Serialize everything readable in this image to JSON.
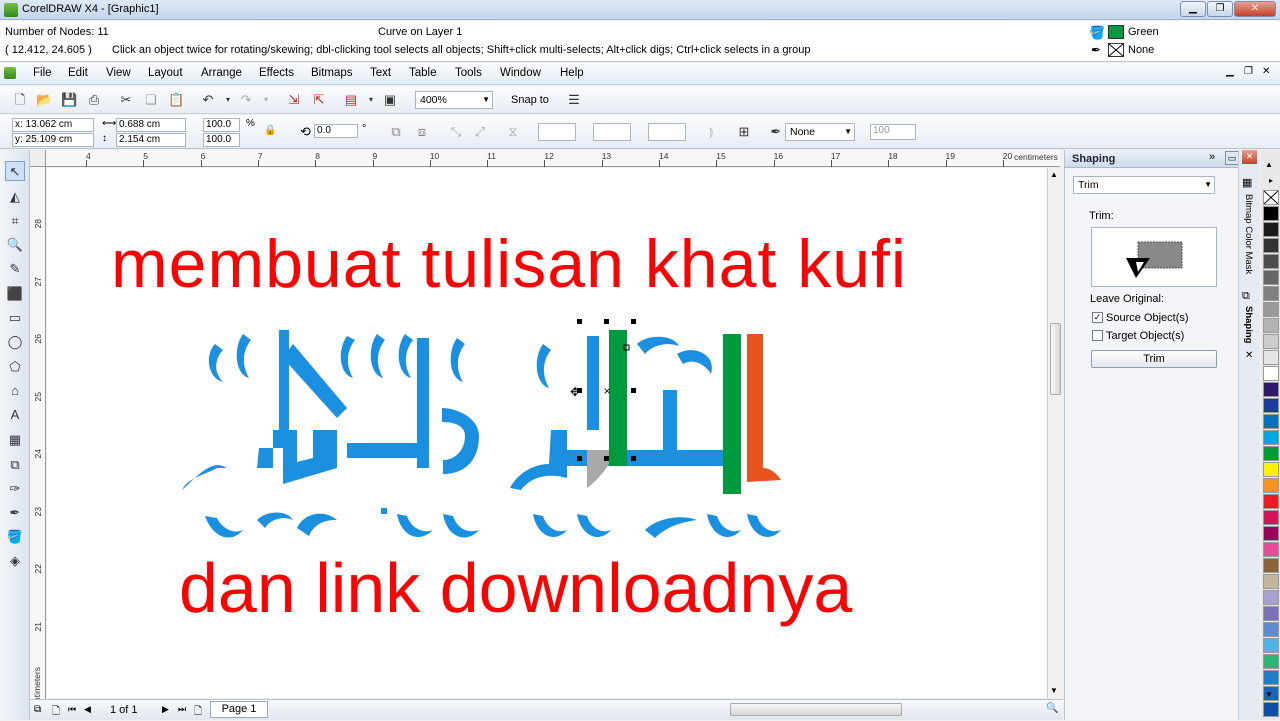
{
  "window": {
    "title": "CorelDRAW X4 - [Graphic1]"
  },
  "status": {
    "nodes": "Number of Nodes: 11",
    "coords": "( 12.412, 24.605 )",
    "object_info": "Curve on Layer 1",
    "hint": "Click an object twice for rotating/skewing; dbl-clicking tool selects all objects; Shift+click multi-selects; Alt+click digs; Ctrl+click selects in a group",
    "fill_label": "Green",
    "outline_label": "None",
    "fill_color": "#009a3e"
  },
  "menu": [
    "File",
    "Edit",
    "View",
    "Layout",
    "Arrange",
    "Effects",
    "Bitmaps",
    "Text",
    "Table",
    "Tools",
    "Window",
    "Help"
  ],
  "toolbar": {
    "zoom": "400%",
    "snap": "Snap to"
  },
  "props": {
    "x": "x: 13.062 cm",
    "y": "y: 25.109 cm",
    "w": "0.688 cm",
    "h": "2.154 cm",
    "sx": "100.0",
    "sy": "100.0",
    "pct": "%",
    "angle": "0.0",
    "deg": "°",
    "outline": "None",
    "opacity": "100"
  },
  "ruler": {
    "h_ticks": [
      "4",
      "5",
      "6",
      "7",
      "8",
      "9",
      "10",
      "11",
      "12",
      "13",
      "14",
      "15",
      "16",
      "17",
      "18",
      "19",
      "20"
    ],
    "h_unit": "centimeters",
    "v_ticks": [
      "28",
      "27",
      "26",
      "25",
      "24",
      "23",
      "22",
      "21"
    ],
    "v_unit": "centimeters"
  },
  "canvas": {
    "headline": "membuat tulisan khat kufi",
    "subline": "dan link downloadnya",
    "text_color": "#ff0000",
    "kufi_left_color": "#1b8fe0",
    "kufi_green": "#009a3e",
    "kufi_orange": "#e8541e",
    "kufi_gray": "#a9a9a9"
  },
  "pages": {
    "counter": "1 of 1",
    "tab": "Page 1"
  },
  "docker": {
    "title": "Shaping",
    "mode": "Trim",
    "section": "Trim:",
    "leave_original": "Leave Original:",
    "source": "Source Object(s)",
    "target": "Target Object(s)",
    "source_checked": true,
    "target_checked": false,
    "apply": "Trim",
    "tab_bitmap": "Bitmap Color Mask",
    "tab_shaping": "Shaping"
  },
  "palette": [
    "#ffffff",
    "#000000",
    "#1a1a1a",
    "#333333",
    "#4d4d4d",
    "#666666",
    "#808080",
    "#999999",
    "#b3b3b3",
    "#cccccc",
    "#e6e6e6",
    "#ffffff",
    "#2e1a6b",
    "#1c3b9e",
    "#0071bc",
    "#00a8e0",
    "#009a3e",
    "#fff200",
    "#f7941d",
    "#ed1c24",
    "#d4145a",
    "#9e005d",
    "#ea4a98",
    "#8c6239",
    "#c2b59b",
    "#a99fd0",
    "#7b6fb8",
    "#5b8bd0",
    "#4fb3e8",
    "#2bb673",
    "#1d80c4",
    "#1565c0",
    "#0b4fa8"
  ]
}
